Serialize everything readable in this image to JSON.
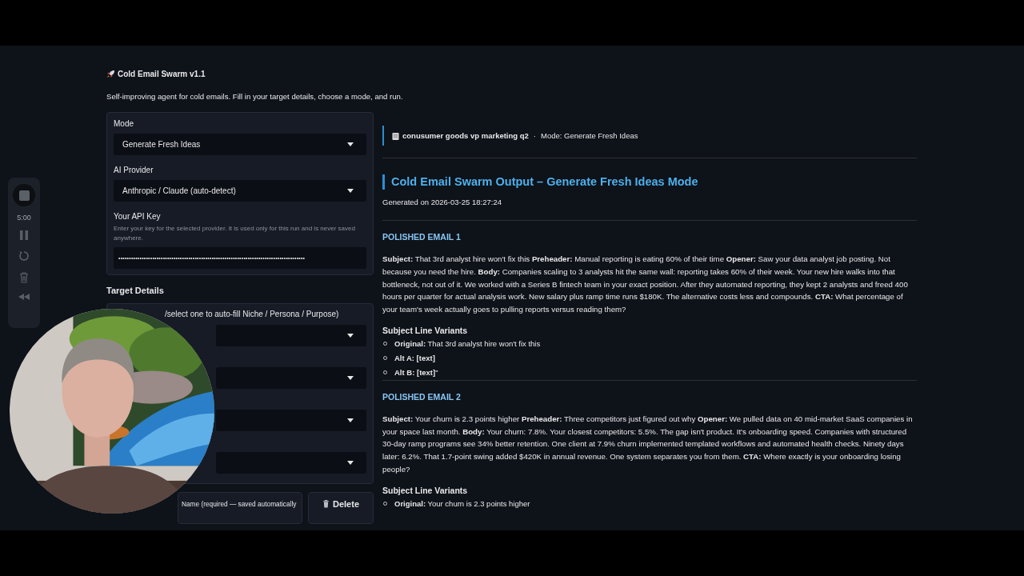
{
  "app": {
    "title": "Cold Email Swarm v1.1",
    "subtitle": "Self-improving agent for cold emails. Fill in your target details, choose a mode, and run."
  },
  "settings": {
    "mode": {
      "label": "Mode",
      "value": "Generate Fresh Ideas"
    },
    "provider": {
      "label": "AI Provider",
      "value": "Anthropic / Claude (auto-detect)"
    },
    "api_key": {
      "label": "Your API Key",
      "help": "Enter your key for the selected provider. It is used only for this run and is never saved anywhere.",
      "value": "••••••••••••••••••••••••••••••••••••••••••••••••••••••••••••••••••••••••••••••••••••••••"
    }
  },
  "target": {
    "title": "Target Details",
    "preset_label": "/select one to auto-fill Niche / Persona / Purpose)",
    "fields": [
      {
        "kind": "select"
      },
      {
        "kind": "select"
      },
      {
        "kind": "select"
      },
      {
        "kind": "select"
      }
    ],
    "campaign_label": "Name (required — saved automatically",
    "delete_button": "Delete"
  },
  "recorder": {
    "time": "5:00"
  },
  "banner": {
    "campaign": "conusumer goods vp marketing q2",
    "separator": "·",
    "mode": "Mode: Generate Fresh Ideas"
  },
  "output": {
    "heading": "Cold Email Swarm Output – Generate Fresh Ideas Mode",
    "generated": "Generated on 2026-03-25 18:27:24",
    "emails": [
      {
        "title": "POLISHED EMAIL 1",
        "body": "**Subject:** That 3rd analyst hire won't fix this **Preheader:** Manual reporting is eating 60% of their time **Opener:** Saw your data analyst job posting. Not because you need the hire. **Body:** Companies scaling to 3 analysts hit the same wall: reporting takes 60% of their week. Your new hire walks into that bottleneck, not out of it. We worked with a Series B fintech team in your exact position. After they automated reporting, they kept 2 analysts and freed 400 hours per quarter for actual analysis work. New salary plus ramp time runs $180K. The alternative costs less and compounds. **CTA:** What percentage of your team's week actually goes to pulling reports versus reading them?",
        "variants_title": "Subject Line Variants",
        "variants": [
          "**Original:** That 3rd analyst hire won't fix this",
          "**Alt A: [text]**",
          "**Alt B: [text]**\""
        ]
      },
      {
        "title": "POLISHED EMAIL 2",
        "body": "**Subject:** Your churn is 2.3 points higher **Preheader:** Three competitors just figured out why **Opener:** We pulled data on 40 mid-market SaaS companies in your space last month. **Body:** Your churn: 7.8%. Your closest competitors: 5.5%. The gap isn't product. It's onboarding speed. Companies with structured 30-day ramp programs see 34% better retention. One client at 7.9% churn implemented templated workflows and automated health checks. Ninety days later: 6.2%. That 1.7-point swing added $420K in annual revenue. One system separates you from them. **CTA:** Where exactly is your onboarding losing people?",
        "variants_title": "Subject Line Variants",
        "variants": [
          "**Original:** Your churn is 2.3 points higher"
        ]
      }
    ]
  }
}
